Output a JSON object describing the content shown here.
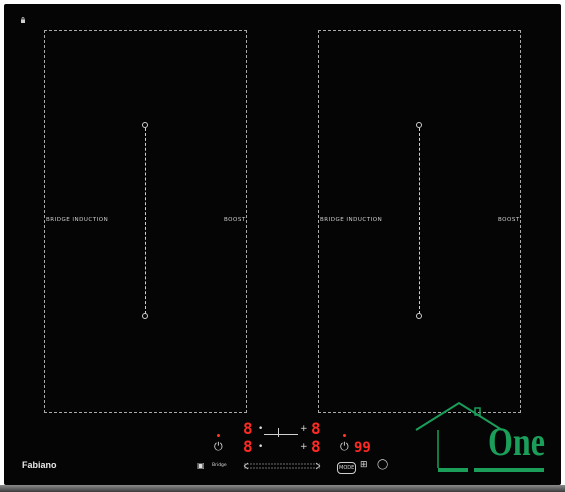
{
  "hob": {
    "brand": "Fabiano",
    "zones": [
      {
        "bridge_label": "BRIDGE INDUCTION",
        "boost_label": "BOOST"
      },
      {
        "bridge_label": "BRIDGE INDUCTION",
        "boost_label": "BOOST"
      }
    ],
    "display": {
      "top_left_digit": "8",
      "top_right_digit": "8",
      "bottom_left_digit": "8",
      "bottom_right_digit": "8",
      "timer": "99"
    },
    "controls": {
      "bridge_label": "Bridge",
      "mode_label": "MODE"
    }
  },
  "watermark": {
    "text": "One",
    "color": "#1a9e5a"
  }
}
